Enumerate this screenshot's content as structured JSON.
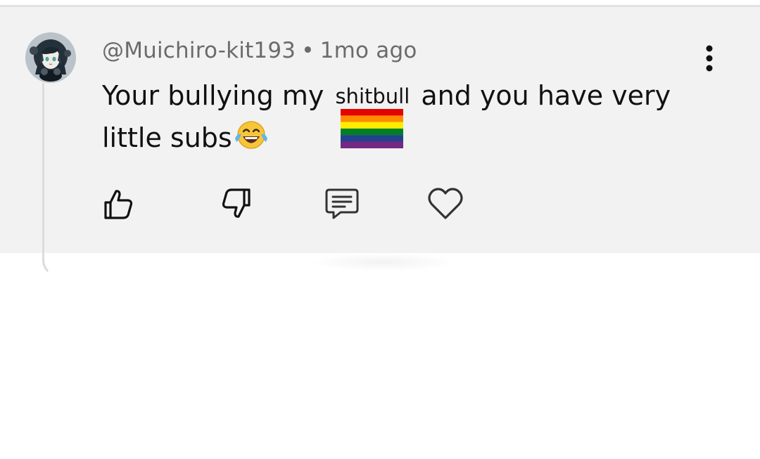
{
  "comment": {
    "username": "@Muichiro-kit193",
    "separator": "•",
    "timestamp": "1mo ago",
    "text_part1": "Your bullying my",
    "small_word": "shitbull",
    "text_part2": "and you have very",
    "text_line2": "little subs",
    "emoji": "face-with-tears-of-joy",
    "sticker": "rainbow-flag"
  },
  "actions": {
    "like_icon": "thumbs-up-icon",
    "dislike_icon": "thumbs-down-icon",
    "reply_icon": "comment-icon",
    "heart_icon": "heart-icon",
    "more_icon": "more-vertical-icon"
  },
  "colors": {
    "card_background": "#f2f2f2",
    "meta_text": "#6b6b6b",
    "body_text": "#111111",
    "icon_stroke": "#111111",
    "thread_line": "#dcdcdc"
  }
}
